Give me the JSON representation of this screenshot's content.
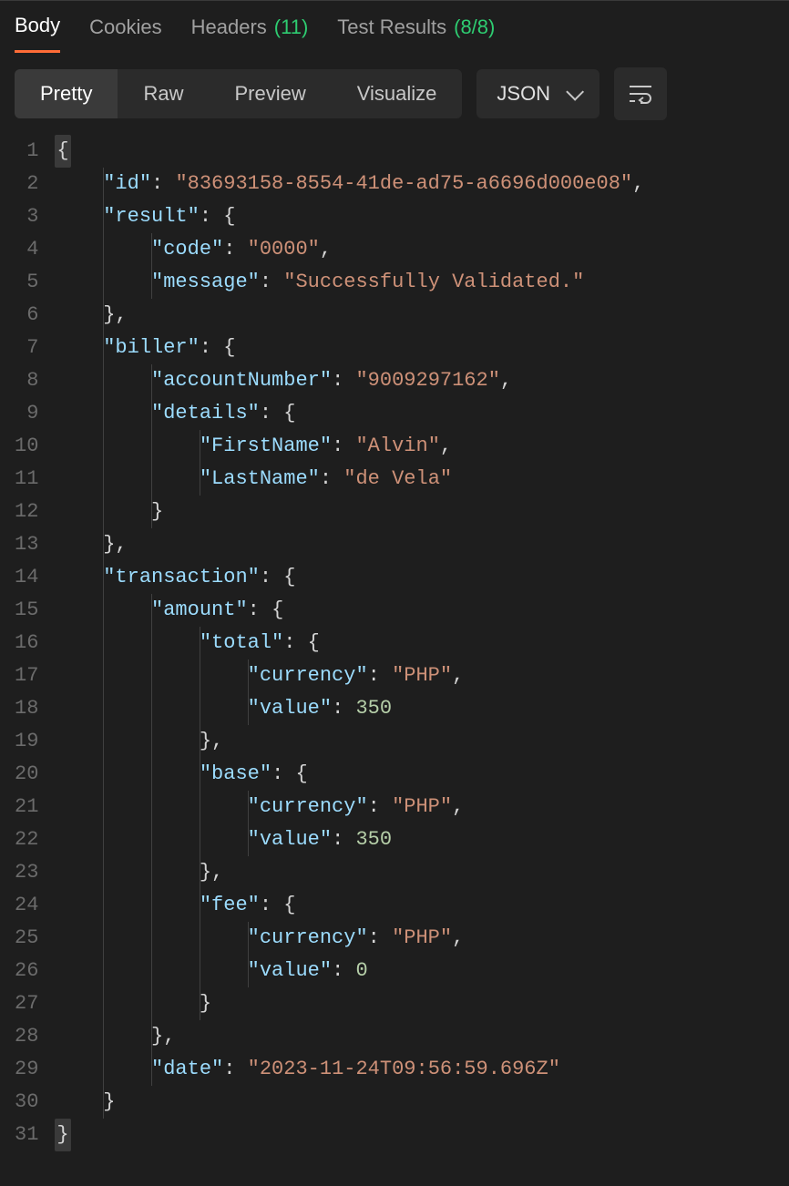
{
  "tabs": {
    "body": "Body",
    "cookies": "Cookies",
    "headers": "Headers",
    "headers_count": "(11)",
    "test_results": "Test Results",
    "test_results_count": "(8/8)"
  },
  "viewmodes": {
    "pretty": "Pretty",
    "raw": "Raw",
    "preview": "Preview",
    "visualize": "Visualize"
  },
  "format_select": "JSON",
  "code": {
    "line_numbers": [
      "1",
      "2",
      "3",
      "4",
      "5",
      "6",
      "7",
      "8",
      "9",
      "10",
      "11",
      "12",
      "13",
      "14",
      "15",
      "16",
      "17",
      "18",
      "19",
      "20",
      "21",
      "22",
      "23",
      "24",
      "25",
      "26",
      "27",
      "28",
      "29",
      "30",
      "31"
    ],
    "tokens": {
      "id_key": "\"id\"",
      "id_val": "\"83693158-8554-41de-ad75-a6696d000e08\"",
      "result_key": "\"result\"",
      "code_key": "\"code\"",
      "code_val": "\"0000\"",
      "message_key": "\"message\"",
      "message_val": "\"Successfully Validated.\"",
      "biller_key": "\"biller\"",
      "accountNumber_key": "\"accountNumber\"",
      "accountNumber_val": "\"9009297162\"",
      "details_key": "\"details\"",
      "FirstName_key": "\"FirstName\"",
      "FirstName_val": "\"Alvin\"",
      "LastName_key": "\"LastName\"",
      "LastName_val": "\"de Vela\"",
      "transaction_key": "\"transaction\"",
      "amount_key": "\"amount\"",
      "total_key": "\"total\"",
      "currency_key": "\"currency\"",
      "currency_val": "\"PHP\"",
      "value_key": "\"value\"",
      "value_350": "350",
      "base_key": "\"base\"",
      "fee_key": "\"fee\"",
      "value_0": "0",
      "date_key": "\"date\"",
      "date_val": "\"2023-11-24T09:56:59.696Z\"",
      "ob": "{",
      "cb": "}",
      "colon": ":",
      "comma": ","
    }
  }
}
